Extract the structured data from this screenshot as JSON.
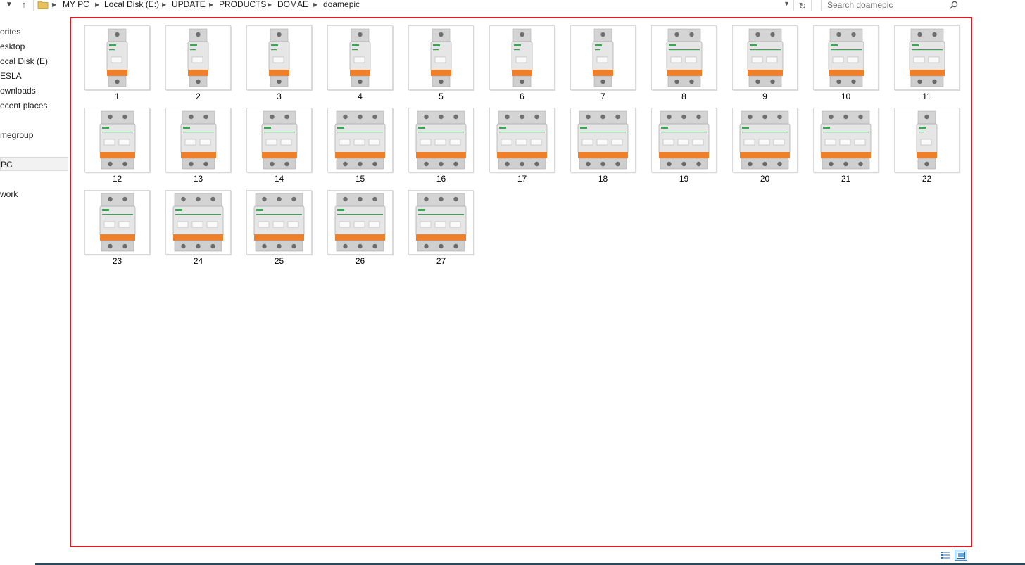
{
  "address": {
    "crumbs": [
      "MY PC",
      "Local Disk (E:)",
      "UPDATE",
      "PRODUCTS",
      "DOMAE",
      "doamepic"
    ],
    "icons": {
      "back": "chevron-down-icon",
      "up": "up-arrow-icon",
      "folder": "folder-icon",
      "refresh": "refresh-icon"
    }
  },
  "search": {
    "placeholder": "Search doamepic",
    "value": "",
    "icon": "search-icon"
  },
  "navpane": {
    "items": [
      {
        "label": "orites"
      },
      {
        "label": "esktop"
      },
      {
        "label": "ocal Disk (E)"
      },
      {
        "label": "ESLA"
      },
      {
        "label": "ownloads"
      },
      {
        "label": "ecent places"
      },
      {
        "label": "megroup"
      },
      {
        "label": " PC",
        "selected": true
      },
      {
        "label": "work"
      }
    ]
  },
  "files": {
    "items": [
      {
        "name": "1",
        "poles": 1
      },
      {
        "name": "2",
        "poles": 1
      },
      {
        "name": "3",
        "poles": 1
      },
      {
        "name": "4",
        "poles": 1
      },
      {
        "name": "5",
        "poles": 1
      },
      {
        "name": "6",
        "poles": 1
      },
      {
        "name": "7",
        "poles": 1
      },
      {
        "name": "8",
        "poles": 2
      },
      {
        "name": "9",
        "poles": 2
      },
      {
        "name": "10",
        "poles": 2
      },
      {
        "name": "11",
        "poles": 2
      },
      {
        "name": "12",
        "poles": 2
      },
      {
        "name": "13",
        "poles": 2
      },
      {
        "name": "14",
        "poles": 2
      },
      {
        "name": "15",
        "poles": 3
      },
      {
        "name": "16",
        "poles": 3
      },
      {
        "name": "17",
        "poles": 3
      },
      {
        "name": "18",
        "poles": 3
      },
      {
        "name": "19",
        "poles": 3
      },
      {
        "name": "20",
        "poles": 3
      },
      {
        "name": "21",
        "poles": 3
      },
      {
        "name": "22",
        "poles": 1
      },
      {
        "name": "23",
        "poles": 2
      },
      {
        "name": "24",
        "poles": 3
      },
      {
        "name": "25",
        "poles": 3
      },
      {
        "name": "26",
        "poles": 3
      },
      {
        "name": "27",
        "poles": 3
      }
    ]
  },
  "statusbar": {
    "view_details_icon": "details-view-icon",
    "view_large_icon": "large-icons-view-icon",
    "active_view": "large-icons"
  },
  "colors": {
    "selection_border": "#d81f26",
    "breaker_orange": "#f07f2a",
    "breaker_body": "#e6e6e6",
    "brand_green": "#3aa655"
  }
}
